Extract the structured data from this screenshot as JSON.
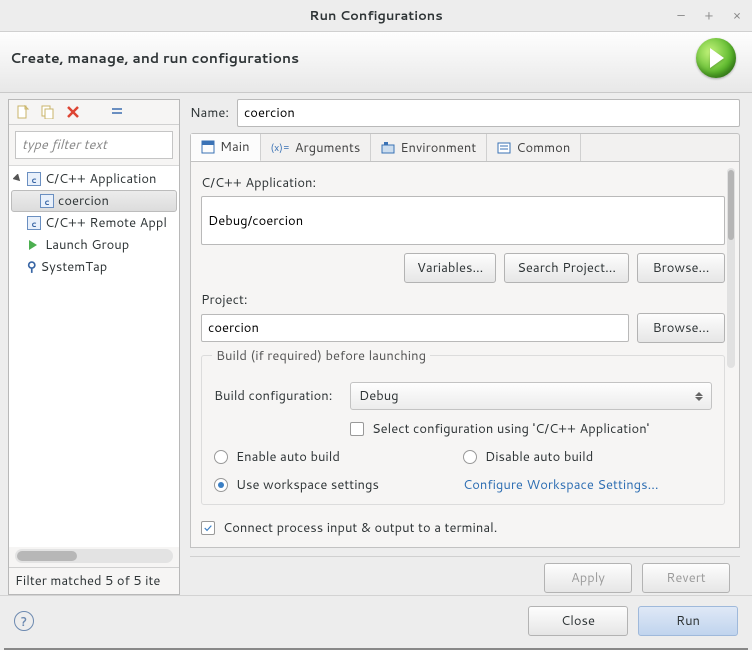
{
  "window": {
    "title": "Run Configurations"
  },
  "header": {
    "text": "Create, manage, and run configurations"
  },
  "left": {
    "filter_placeholder": "type filter text",
    "items": {
      "cpp_app": "C/C++ Application",
      "coercion": "coercion",
      "cpp_remote": "C/C++ Remote Appl",
      "launch_group": "Launch Group",
      "systemtap": "SystemTap"
    },
    "match": "Filter matched 5 of 5 ite"
  },
  "name": {
    "label": "Name:",
    "value": "coercion"
  },
  "tabs": {
    "main": "Main",
    "arguments": "Arguments",
    "environment": "Environment",
    "common": "Common"
  },
  "main": {
    "app_label": "C/C++ Application:",
    "app_value": "Debug/coercion",
    "btn_variables": "Variables...",
    "btn_search_project": "Search Project...",
    "btn_browse": "Browse...",
    "project_label": "Project:",
    "project_value": "coercion",
    "btn_browse2": "Browse...",
    "group_title": "Build (if required) before launching",
    "build_config_label": "Build configuration:",
    "build_config_value": "Debug",
    "select_using_app": "Select configuration using 'C/C++ Application'",
    "enable_auto": "Enable auto build",
    "disable_auto": "Disable auto build",
    "use_workspace": "Use workspace settings",
    "cfg_ws_link": "Configure Workspace Settings...",
    "connect_terminal": "Connect process input & output to a terminal."
  },
  "buttons": {
    "apply": "Apply",
    "revert": "Revert",
    "close": "Close",
    "run": "Run"
  }
}
